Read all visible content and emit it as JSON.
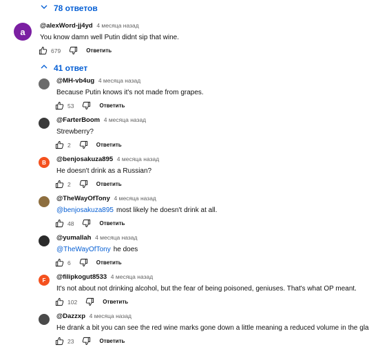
{
  "thread": {
    "collapsed_replies_label": "78 ответов",
    "expanded_replies_label": "41 ответ"
  },
  "top_comment": {
    "author": "@alexWord-jj4yd",
    "time": "4 месяца назад",
    "text": "You know damn well Putin didnt sip that wine.",
    "likes": "679",
    "reply_label": "Ответить",
    "avatar_letter": "a",
    "avatar_color": "#7b1fa2"
  },
  "replies": [
    {
      "author": "@MH-vb4ug",
      "time": "4 месяца назад",
      "mention": "",
      "text": "Because Putin knows it's not made from grapes.",
      "likes": "53",
      "reply_label": "Ответить",
      "avatar_letter": "",
      "avatar_color": "#6b6b6b"
    },
    {
      "author": "@FarterBoom",
      "time": "4 месяца назад",
      "mention": "",
      "text": "Strewberry?",
      "likes": "2",
      "reply_label": "Ответить",
      "avatar_letter": "",
      "avatar_color": "#3a3a3a"
    },
    {
      "author": "@benjosakuza895",
      "time": "4 месяца назад",
      "mention": "",
      "text": "He doesn't drink as a Russian?",
      "likes": "2",
      "reply_label": "Ответить",
      "avatar_letter": "B",
      "avatar_color": "#f4511e"
    },
    {
      "author": "@TheWayOfTony",
      "time": "4 месяца назад",
      "mention": "@benjosakuza895",
      "text": "most likely he doesn't drink at all.",
      "likes": "48",
      "reply_label": "Ответить",
      "avatar_letter": "",
      "avatar_color": "#8d6e3f"
    },
    {
      "author": "@yumallah",
      "time": "4 месяца назад",
      "mention": "@TheWayOfTony",
      "text": "he does",
      "likes": "6",
      "reply_label": "Ответить",
      "avatar_letter": "",
      "avatar_color": "#2b2b2b"
    },
    {
      "author": "@filipkogut8533",
      "time": "4 месяца назад",
      "mention": "",
      "text": "It's not about not drinking alcohol, but the fear of being poisoned, geniuses. That's what OP meant.",
      "likes": "102",
      "reply_label": "Ответить",
      "avatar_letter": "F",
      "avatar_color": "#f4511e"
    },
    {
      "author": "@Dazzxp",
      "time": "4 месяца назад",
      "mention": "",
      "text": "He drank a bit you can see the red wine marks gone down a little meaning a reduced volume in the glass.",
      "likes": "23",
      "reply_label": "Ответить",
      "avatar_letter": "",
      "avatar_color": "#4a4a4a"
    }
  ]
}
